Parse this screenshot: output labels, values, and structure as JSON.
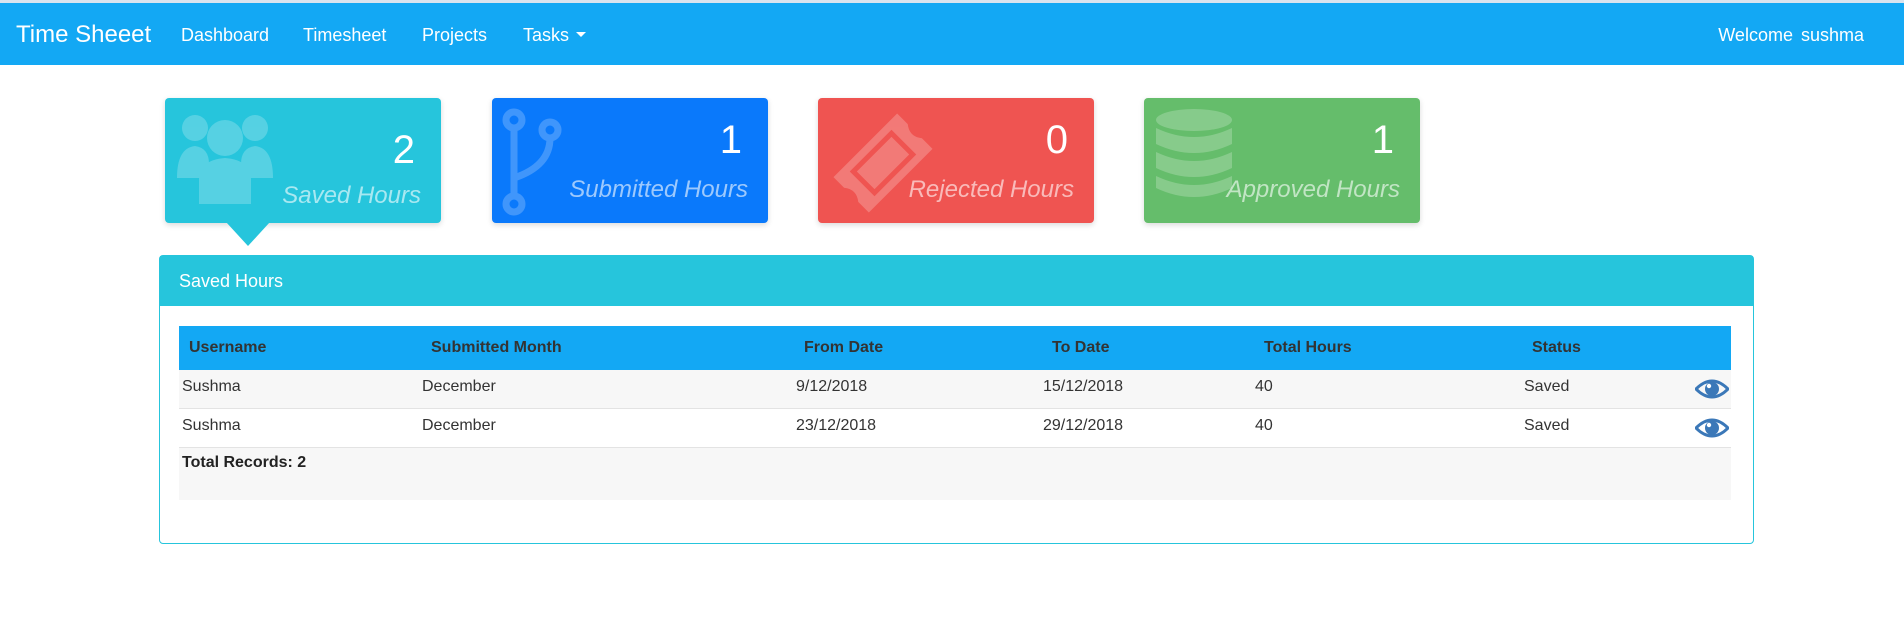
{
  "navbar": {
    "brand": "Time Sheeet",
    "links": [
      "Dashboard",
      "Timesheet",
      "Projects",
      "Tasks"
    ],
    "welcome_label": "Welcome",
    "username": "sushma"
  },
  "cards": [
    {
      "value": "2",
      "label": "Saved Hours",
      "color": "#26c5dc",
      "icon": "users-icon"
    },
    {
      "value": "1",
      "label": "Submitted Hours",
      "color": "#0a79fb",
      "icon": "code-fork-icon"
    },
    {
      "value": "0",
      "label": "Rejected Hours",
      "color": "#ef5451",
      "icon": "ticket-icon"
    },
    {
      "value": "1",
      "label": "Approved Hours",
      "color": "#65bd6b",
      "icon": "database-icon"
    }
  ],
  "panel": {
    "title": "Saved Hours",
    "columns": [
      "Username",
      "Submitted Month",
      "From Date",
      "To Date",
      "Total Hours",
      "Status"
    ],
    "rows": [
      [
        "Sushma",
        "December",
        "9/12/2018",
        "15/12/2018",
        "40",
        "Saved"
      ],
      [
        "Sushma",
        "December",
        "23/12/2018",
        "29/12/2018",
        "40",
        "Saved"
      ]
    ],
    "total_records": "Total Records: 2"
  },
  "colors": {
    "navbar": "#13a8f4",
    "accent_cyan": "#26c5dc",
    "eye_icon": "#3b78b8"
  }
}
